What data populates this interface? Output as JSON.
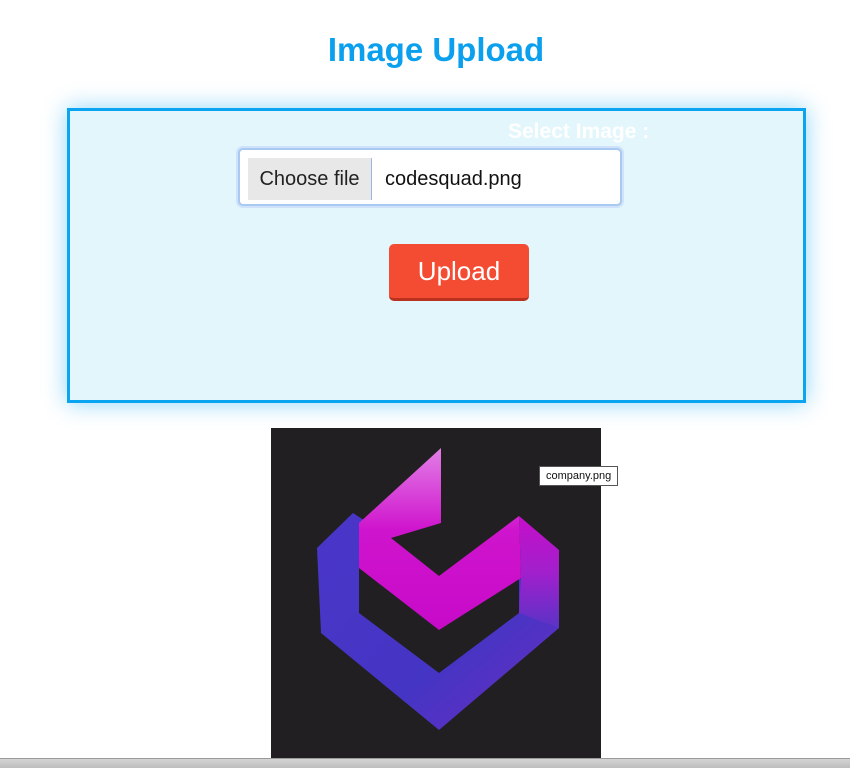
{
  "page": {
    "title": "Image Upload"
  },
  "form": {
    "select_label": "Select Image :",
    "choose_button_label": "Choose file",
    "selected_file_name": "codesquad.png",
    "upload_button_label": "Upload"
  },
  "preview": {
    "tooltip_text": "company.png",
    "logo_icon": "codesquad-logo-icon"
  },
  "colors": {
    "title": "#0aa0ee",
    "panel_border": "#0aa4f0",
    "panel_background": "#e2f6fc",
    "upload_button": "#f44b33",
    "preview_background": "#211f21",
    "logo_magenta": "#d30fcf",
    "logo_purple": "#4a35c8"
  }
}
